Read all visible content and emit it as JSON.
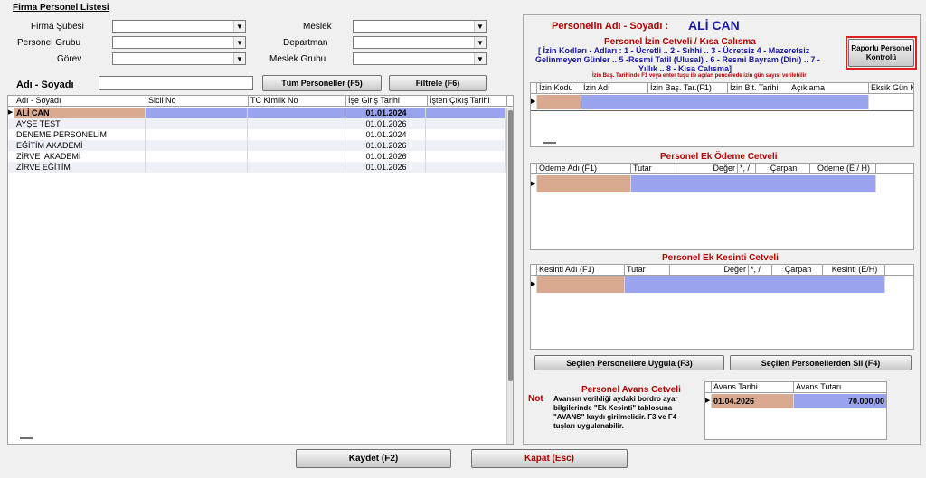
{
  "left": {
    "section_title": "Firma Personel Listesi",
    "filters": {
      "firma_subesi": "Firma Şubesi",
      "meslek": "Meslek",
      "personel_grubu": "Personel Grubu",
      "departman": "Departman",
      "gorev": "Görev",
      "meslek_grubu": "Meslek Grubu"
    },
    "name_label": "Adı - Soyadı",
    "btn_all": "Tüm Personeller (F5)",
    "btn_filter": "Filtrele (F6)",
    "columns": [
      "Adı - Soyadı",
      "Sicil No",
      "TC Kimlik No",
      "İşe Giriş Tarihi",
      "İşten Çıkış Tarihi"
    ],
    "rows": [
      {
        "name": "ALİ CAN",
        "sicil": "",
        "tc": "",
        "giris": "01.01.2024",
        "cikis": ""
      },
      {
        "name": "AYŞE TEST",
        "sicil": "",
        "tc": "",
        "giris": "01.01.2026",
        "cikis": ""
      },
      {
        "name": "DENEME PERSONELİM",
        "sicil": "",
        "tc": "",
        "giris": "01.01.2024",
        "cikis": ""
      },
      {
        "name": "EĞİTİM AKADEMİ",
        "sicil": "",
        "tc": "",
        "giris": "01.01.2026",
        "cikis": ""
      },
      {
        "name": "ZİRVE  AKADEMİ",
        "sicil": "",
        "tc": "",
        "giris": "01.01.2026",
        "cikis": ""
      },
      {
        "name": "ZİRVE EĞİTİM",
        "sicil": "",
        "tc": "",
        "giris": "01.01.2026",
        "cikis": ""
      }
    ]
  },
  "right": {
    "person_label": "Personelin Adı - Soyadı :",
    "person_name": "ALİ CAN",
    "izin": {
      "title": "Personel İzin Cetveli / Kısa Calısma",
      "codes_line1": "[ İzin Kodları - Adları : 1 - Ücretli .. 2 - Sıhhi .. 3 - Ücretsiz  4 - Mazeretsiz",
      "codes_line2": "Gelinmeyen Günler .. 5 -Resmi Tatil (Ulusal) . 6 - Resmi Bayram (Dini) .. 7 -",
      "codes_line3": "Yıllık .. 8 - Kısa Calısma]",
      "hint": "İzin Baş. Tarihinde F1 veya enter tuşu ile açılan pencerede izin gün sayısı verilebilir",
      "btn_rapor": "Raporlu Personel Kontrolü",
      "columns": [
        "İzin Kodu",
        "İzin Adı",
        "İzin Baş. Tar.(F1)",
        "İzin Bit. Tarihi",
        "Açıklama",
        "Eksik Gün Ne"
      ]
    },
    "odeme": {
      "title": "Personel Ek Ödeme Cetveli",
      "columns": [
        "Ödeme Adı (F1)",
        "Tutar",
        "Değer",
        "*, /",
        "Çarpan",
        "Ödeme (E / H)"
      ]
    },
    "kesinti": {
      "title": "Personel Ek Kesinti Cetveli",
      "columns": [
        "Kesinti Adı (F1)",
        "Tutar",
        "Değer",
        "*, /",
        "Çarpan",
        "Kesinti (E/H)"
      ]
    },
    "btn_apply": "Seçilen Personellere Uygula (F3)",
    "btn_delete": "Seçilen Personellerden Sil (F4)",
    "avans": {
      "title": "Personel Avans Cetveli",
      "not_label": "Not",
      "note": "Avansın verildiği aydaki bordro ayar bilgilerinde \"Ek Kesinti\" tablosuna \"AVANS\" kaydı girilmelidir. F3 ve F4 tuşları uygulanabilir.",
      "columns": [
        "Avans Tarihi",
        "Avans Tutarı"
      ],
      "date": "01.04.2026",
      "amount": "70.000,00"
    }
  },
  "bottom": {
    "btn_save": "Kaydet (F2)",
    "btn_close": "Kapat (Esc)"
  },
  "colors": {
    "selected_row": "#d9a98f",
    "cell_blue": "#9aa4ee",
    "title_red": "#b30000",
    "title_blue": "#1a1aa6"
  }
}
